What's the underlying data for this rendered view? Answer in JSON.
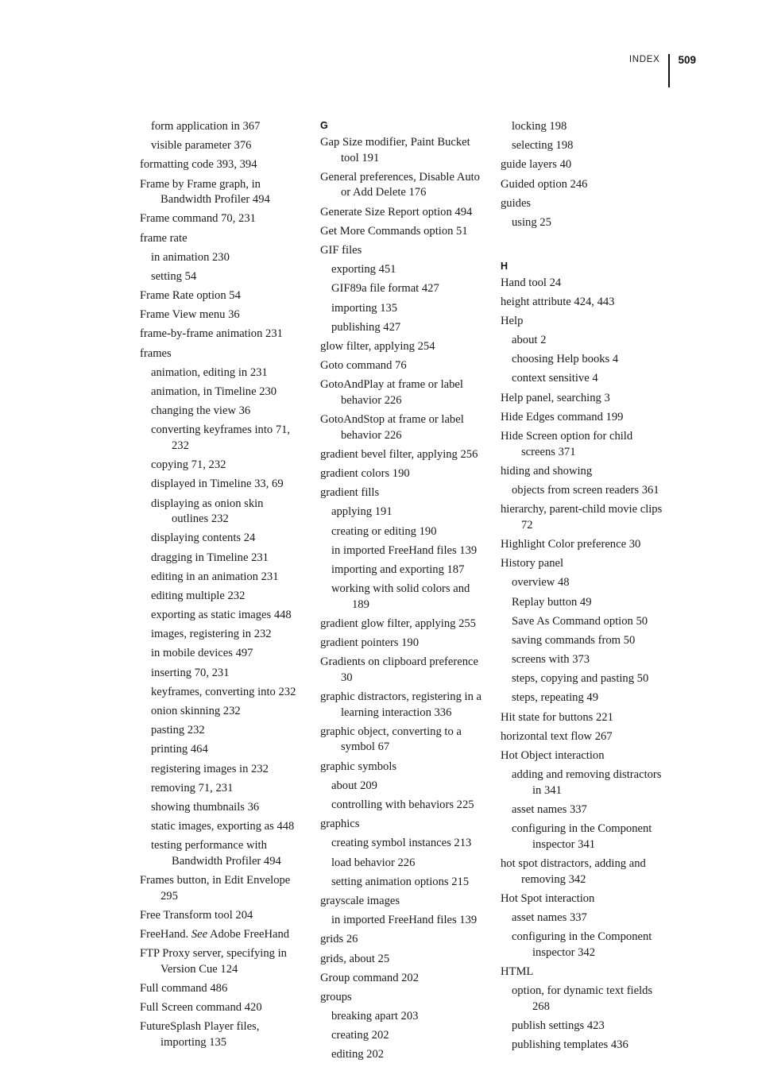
{
  "running_head": {
    "label": "INDEX",
    "folio": "509"
  },
  "columns": [
    {
      "id": "column-1",
      "blocks": [
        {
          "type": "entry",
          "level": "sub",
          "text": "form application in 367"
        },
        {
          "type": "entry",
          "level": "sub",
          "text": "visible parameter 376"
        },
        {
          "type": "entry",
          "level": "main",
          "text": "formatting code 393, 394"
        },
        {
          "type": "entry",
          "level": "main",
          "text": "Frame by Frame graph, in Bandwidth Profiler 494"
        },
        {
          "type": "entry",
          "level": "main",
          "text": "Frame command 70, 231"
        },
        {
          "type": "entry",
          "level": "main",
          "text": "frame rate"
        },
        {
          "type": "entry",
          "level": "sub",
          "text": "in animation 230"
        },
        {
          "type": "entry",
          "level": "sub",
          "text": "setting 54"
        },
        {
          "type": "entry",
          "level": "main",
          "text": "Frame Rate option 54"
        },
        {
          "type": "entry",
          "level": "main",
          "text": "Frame View menu 36"
        },
        {
          "type": "entry",
          "level": "main",
          "text": "frame-by-frame animation 231"
        },
        {
          "type": "entry",
          "level": "main",
          "text": "frames"
        },
        {
          "type": "entry",
          "level": "sub",
          "text": "animation, editing in 231"
        },
        {
          "type": "entry",
          "level": "sub",
          "text": "animation, in Timeline 230"
        },
        {
          "type": "entry",
          "level": "sub",
          "text": "changing the view 36"
        },
        {
          "type": "entry",
          "level": "sub",
          "text": "converting keyframes into 71, 232"
        },
        {
          "type": "entry",
          "level": "sub",
          "text": "copying 71, 232"
        },
        {
          "type": "entry",
          "level": "sub",
          "text": "displayed in Timeline 33, 69"
        },
        {
          "type": "entry",
          "level": "sub",
          "text": "displaying as onion skin outlines 232"
        },
        {
          "type": "entry",
          "level": "sub",
          "text": "displaying contents 24"
        },
        {
          "type": "entry",
          "level": "sub",
          "text": "dragging in Timeline 231"
        },
        {
          "type": "entry",
          "level": "sub",
          "text": "editing in an animation 231"
        },
        {
          "type": "entry",
          "level": "sub",
          "text": "editing multiple 232"
        },
        {
          "type": "entry",
          "level": "sub",
          "text": "exporting as static images 448"
        },
        {
          "type": "entry",
          "level": "sub",
          "text": "images, registering in 232"
        },
        {
          "type": "entry",
          "level": "sub",
          "text": "in mobile devices 497"
        },
        {
          "type": "entry",
          "level": "sub",
          "text": "inserting 70, 231"
        },
        {
          "type": "entry",
          "level": "sub",
          "text": "keyframes, converting into 232"
        },
        {
          "type": "entry",
          "level": "sub",
          "text": "onion skinning 232"
        },
        {
          "type": "entry",
          "level": "sub",
          "text": "pasting 232"
        },
        {
          "type": "entry",
          "level": "sub",
          "text": "printing 464"
        },
        {
          "type": "entry",
          "level": "sub",
          "text": "registering images in 232"
        },
        {
          "type": "entry",
          "level": "sub",
          "text": "removing 71, 231"
        },
        {
          "type": "entry",
          "level": "sub",
          "text": "showing thumbnails 36"
        },
        {
          "type": "entry",
          "level": "sub",
          "text": "static images, exporting as 448"
        },
        {
          "type": "entry",
          "level": "sub",
          "text": "testing performance with Bandwidth Profiler 494"
        },
        {
          "type": "entry",
          "level": "main",
          "text": "Frames button, in Edit Envelope 295"
        },
        {
          "type": "entry",
          "level": "main",
          "text": "Free Transform tool 204"
        },
        {
          "type": "entry",
          "level": "main",
          "html": "FreeHand. <i>See</i> Adobe FreeHand"
        },
        {
          "type": "entry",
          "level": "main",
          "text": "FTP Proxy server, specifying in Version Cue 124"
        },
        {
          "type": "entry",
          "level": "main",
          "text": "Full command 486"
        },
        {
          "type": "entry",
          "level": "main",
          "text": "Full Screen command 420"
        },
        {
          "type": "entry",
          "level": "main",
          "text": "FutureSplash Player files, importing 135"
        }
      ]
    },
    {
      "id": "column-2",
      "blocks": [
        {
          "type": "letter",
          "text": "G"
        },
        {
          "type": "entry",
          "level": "main",
          "text": "Gap Size modifier, Paint Bucket tool 191"
        },
        {
          "type": "entry",
          "level": "main",
          "text": "General preferences, Disable Auto or Add Delete 176"
        },
        {
          "type": "entry",
          "level": "main",
          "text": "Generate Size Report option 494"
        },
        {
          "type": "entry",
          "level": "main",
          "text": "Get More Commands option 51"
        },
        {
          "type": "entry",
          "level": "main",
          "text": "GIF files"
        },
        {
          "type": "entry",
          "level": "sub",
          "text": "exporting 451"
        },
        {
          "type": "entry",
          "level": "sub",
          "text": "GIF89a file format 427"
        },
        {
          "type": "entry",
          "level": "sub",
          "text": "importing 135"
        },
        {
          "type": "entry",
          "level": "sub",
          "text": "publishing 427"
        },
        {
          "type": "entry",
          "level": "main",
          "text": "glow filter, applying 254"
        },
        {
          "type": "entry",
          "level": "main",
          "text": "Goto command 76"
        },
        {
          "type": "entry",
          "level": "main",
          "text": "GotoAndPlay at frame or label behavior 226"
        },
        {
          "type": "entry",
          "level": "main",
          "text": "GotoAndStop at frame or label behavior 226"
        },
        {
          "type": "entry",
          "level": "main",
          "text": "gradient bevel filter, applying 256"
        },
        {
          "type": "entry",
          "level": "main",
          "text": "gradient colors 190"
        },
        {
          "type": "entry",
          "level": "main",
          "text": "gradient fills"
        },
        {
          "type": "entry",
          "level": "sub",
          "text": "applying 191"
        },
        {
          "type": "entry",
          "level": "sub",
          "text": "creating or editing 190"
        },
        {
          "type": "entry",
          "level": "sub",
          "text": "in imported FreeHand files 139"
        },
        {
          "type": "entry",
          "level": "sub",
          "text": "importing and exporting 187"
        },
        {
          "type": "entry",
          "level": "sub",
          "text": "working with solid colors and 189"
        },
        {
          "type": "entry",
          "level": "main",
          "text": "gradient glow filter, applying 255"
        },
        {
          "type": "entry",
          "level": "main",
          "text": "gradient pointers 190"
        },
        {
          "type": "entry",
          "level": "main",
          "text": "Gradients on clipboard preference 30"
        },
        {
          "type": "entry",
          "level": "main",
          "text": "graphic distractors, registering in a learning interaction 336"
        },
        {
          "type": "entry",
          "level": "main",
          "text": "graphic object, converting to a symbol 67"
        },
        {
          "type": "entry",
          "level": "main",
          "text": "graphic symbols"
        },
        {
          "type": "entry",
          "level": "sub",
          "text": "about 209"
        },
        {
          "type": "entry",
          "level": "sub",
          "text": "controlling with behaviors 225"
        },
        {
          "type": "entry",
          "level": "main",
          "text": "graphics"
        },
        {
          "type": "entry",
          "level": "sub",
          "text": "creating symbol instances 213"
        },
        {
          "type": "entry",
          "level": "sub",
          "text": "load behavior 226"
        },
        {
          "type": "entry",
          "level": "sub",
          "text": "setting animation options 215"
        },
        {
          "type": "entry",
          "level": "main",
          "text": "grayscale images"
        },
        {
          "type": "entry",
          "level": "sub",
          "text": "in imported FreeHand files 139"
        },
        {
          "type": "entry",
          "level": "main",
          "text": "grids 26"
        },
        {
          "type": "entry",
          "level": "main",
          "text": "grids, about 25"
        },
        {
          "type": "entry",
          "level": "main",
          "text": "Group command 202"
        },
        {
          "type": "entry",
          "level": "main",
          "text": "groups"
        },
        {
          "type": "entry",
          "level": "sub",
          "text": "breaking apart 203"
        },
        {
          "type": "entry",
          "level": "sub",
          "text": "creating 202"
        },
        {
          "type": "entry",
          "level": "sub",
          "text": "editing 202"
        }
      ]
    },
    {
      "id": "column-3",
      "blocks": [
        {
          "type": "entry",
          "level": "sub",
          "text": "locking 198"
        },
        {
          "type": "entry",
          "level": "sub",
          "text": "selecting 198"
        },
        {
          "type": "entry",
          "level": "main",
          "text": "guide layers 40"
        },
        {
          "type": "entry",
          "level": "main",
          "text": "Guided option 246"
        },
        {
          "type": "entry",
          "level": "main",
          "text": "guides"
        },
        {
          "type": "entry",
          "level": "sub",
          "text": "using 25"
        },
        {
          "type": "letter",
          "text": "H",
          "spaced": true
        },
        {
          "type": "entry",
          "level": "main",
          "text": "Hand tool 24"
        },
        {
          "type": "entry",
          "level": "main",
          "text": "height attribute 424, 443"
        },
        {
          "type": "entry",
          "level": "main",
          "text": "Help"
        },
        {
          "type": "entry",
          "level": "sub",
          "text": "about 2"
        },
        {
          "type": "entry",
          "level": "sub",
          "text": "choosing Help books 4"
        },
        {
          "type": "entry",
          "level": "sub",
          "text": "context sensitive 4"
        },
        {
          "type": "entry",
          "level": "main",
          "text": "Help panel, searching 3"
        },
        {
          "type": "entry",
          "level": "main",
          "text": "Hide Edges command 199"
        },
        {
          "type": "entry",
          "level": "main",
          "text": "Hide Screen option for child screens 371"
        },
        {
          "type": "entry",
          "level": "main",
          "text": "hiding and showing"
        },
        {
          "type": "entry",
          "level": "sub",
          "text": "objects from screen readers 361"
        },
        {
          "type": "entry",
          "level": "main",
          "text": "hierarchy, parent-child movie clips 72"
        },
        {
          "type": "entry",
          "level": "main",
          "text": "Highlight Color preference 30"
        },
        {
          "type": "entry",
          "level": "main",
          "text": "History panel"
        },
        {
          "type": "entry",
          "level": "sub",
          "text": "overview 48"
        },
        {
          "type": "entry",
          "level": "sub",
          "text": "Replay button 49"
        },
        {
          "type": "entry",
          "level": "sub",
          "text": "Save As Command option 50"
        },
        {
          "type": "entry",
          "level": "sub",
          "text": "saving commands from 50"
        },
        {
          "type": "entry",
          "level": "sub",
          "text": "screens with 373"
        },
        {
          "type": "entry",
          "level": "sub",
          "text": "steps, copying and pasting 50"
        },
        {
          "type": "entry",
          "level": "sub",
          "text": "steps, repeating 49"
        },
        {
          "type": "entry",
          "level": "main",
          "text": "Hit state for buttons 221"
        },
        {
          "type": "entry",
          "level": "main",
          "text": "horizontal text flow 267"
        },
        {
          "type": "entry",
          "level": "main",
          "text": "Hot Object interaction"
        },
        {
          "type": "entry",
          "level": "sub",
          "text": "adding and removing distractors in 341"
        },
        {
          "type": "entry",
          "level": "sub",
          "text": "asset names 337"
        },
        {
          "type": "entry",
          "level": "sub",
          "text": "configuring in the Component inspector 341"
        },
        {
          "type": "entry",
          "level": "main",
          "text": "hot spot distractors, adding and removing 342"
        },
        {
          "type": "entry",
          "level": "main",
          "text": "Hot Spot interaction"
        },
        {
          "type": "entry",
          "level": "sub",
          "text": "asset names 337"
        },
        {
          "type": "entry",
          "level": "sub",
          "text": "configuring in the Component inspector 342"
        },
        {
          "type": "entry",
          "level": "main",
          "text": "HTML"
        },
        {
          "type": "entry",
          "level": "sub",
          "text": "option, for dynamic text fields 268"
        },
        {
          "type": "entry",
          "level": "sub",
          "text": "publish settings 423"
        },
        {
          "type": "entry",
          "level": "sub",
          "text": "publishing templates 436"
        }
      ]
    }
  ]
}
